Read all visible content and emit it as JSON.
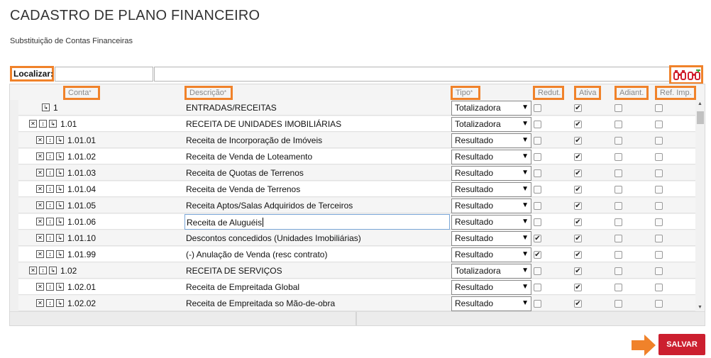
{
  "page": {
    "title": "CADASTRO DE PLANO FINANCEIRO",
    "subtitle": "Substituição de Contas Financeiras"
  },
  "search": {
    "label": "Localizar:",
    "value1": "",
    "value2": ""
  },
  "columns": {
    "conta": "Conta",
    "descricao": "Descrição",
    "tipo": "Tipo",
    "redut": "Redut.",
    "ativa": "Ativa",
    "adiant": "Adiant.",
    "ref_imp": "Ref. Imp.",
    "required_mark": "*"
  },
  "rows": [
    {
      "conta": "1",
      "descricao": "ENTRADAS/RECEITAS",
      "tipo": "Totalizadora",
      "redut": false,
      "ativa": true,
      "adiant": false,
      "ref_imp": false,
      "level": 0,
      "icons": [
        "move"
      ]
    },
    {
      "conta": "1.01",
      "descricao": "RECEITA DE UNIDADES IMOBILIÁRIAS",
      "tipo": "Totalizadora",
      "redut": false,
      "ativa": true,
      "adiant": false,
      "ref_imp": false,
      "level": 1,
      "icons": [
        "delete",
        "add",
        "move"
      ]
    },
    {
      "conta": "1.01.01",
      "descricao": "Receita de Incorporação de Imóveis",
      "tipo": "Resultado",
      "redut": false,
      "ativa": true,
      "adiant": false,
      "ref_imp": false,
      "level": 2,
      "icons": [
        "delete",
        "add",
        "move"
      ]
    },
    {
      "conta": "1.01.02",
      "descricao": "Receita de Venda de Loteamento",
      "tipo": "Resultado",
      "redut": false,
      "ativa": true,
      "adiant": false,
      "ref_imp": false,
      "level": 2,
      "icons": [
        "delete",
        "add",
        "move"
      ]
    },
    {
      "conta": "1.01.03",
      "descricao": "Receita de Quotas de Terrenos",
      "tipo": "Resultado",
      "redut": false,
      "ativa": true,
      "adiant": false,
      "ref_imp": false,
      "level": 2,
      "icons": [
        "delete",
        "add",
        "move"
      ]
    },
    {
      "conta": "1.01.04",
      "descricao": "Receita de Venda de Terrenos",
      "tipo": "Resultado",
      "redut": false,
      "ativa": true,
      "adiant": false,
      "ref_imp": false,
      "level": 2,
      "icons": [
        "delete",
        "add",
        "move"
      ]
    },
    {
      "conta": "1.01.05",
      "descricao": "Receita Aptos/Salas Adquiridos de Terceiros",
      "tipo": "Resultado",
      "redut": false,
      "ativa": true,
      "adiant": false,
      "ref_imp": false,
      "level": 2,
      "icons": [
        "delete",
        "add",
        "move"
      ]
    },
    {
      "conta": "1.01.06",
      "descricao": "Receita de Aluguéis",
      "tipo": "Resultado",
      "redut": false,
      "ativa": true,
      "adiant": false,
      "ref_imp": false,
      "level": 2,
      "icons": [
        "delete",
        "add",
        "move"
      ],
      "editing": true
    },
    {
      "conta": "1.01.10",
      "descricao": "Descontos concedidos (Unidades Imobiliárias)",
      "tipo": "Resultado",
      "redut": true,
      "ativa": true,
      "adiant": false,
      "ref_imp": false,
      "level": 2,
      "icons": [
        "delete",
        "add",
        "move"
      ]
    },
    {
      "conta": "1.01.99",
      "descricao": "(-) Anulação de Venda (resc contrato)",
      "tipo": "Resultado",
      "redut": true,
      "ativa": true,
      "adiant": false,
      "ref_imp": false,
      "level": 2,
      "icons": [
        "delete",
        "add",
        "move"
      ]
    },
    {
      "conta": "1.02",
      "descricao": "RECEITA DE SERVIÇOS",
      "tipo": "Totalizadora",
      "redut": false,
      "ativa": true,
      "adiant": false,
      "ref_imp": false,
      "level": 1,
      "icons": [
        "delete",
        "add",
        "move"
      ]
    },
    {
      "conta": "1.02.01",
      "descricao": "Receita de Empreitada Global",
      "tipo": "Resultado",
      "redut": false,
      "ativa": true,
      "adiant": false,
      "ref_imp": false,
      "level": 2,
      "icons": [
        "delete",
        "add",
        "move"
      ]
    },
    {
      "conta": "1.02.02",
      "descricao": "Receita de Empreitada so Mão-de-obra",
      "tipo": "Resultado",
      "redut": false,
      "ativa": true,
      "adiant": false,
      "ref_imp": false,
      "level": 2,
      "icons": [
        "delete",
        "add",
        "move"
      ]
    }
  ],
  "actions": {
    "save_label": "SALVAR"
  },
  "colors": {
    "highlight": "#f0822a",
    "save": "#cc1f2f",
    "search_icon": "#d0202e"
  }
}
